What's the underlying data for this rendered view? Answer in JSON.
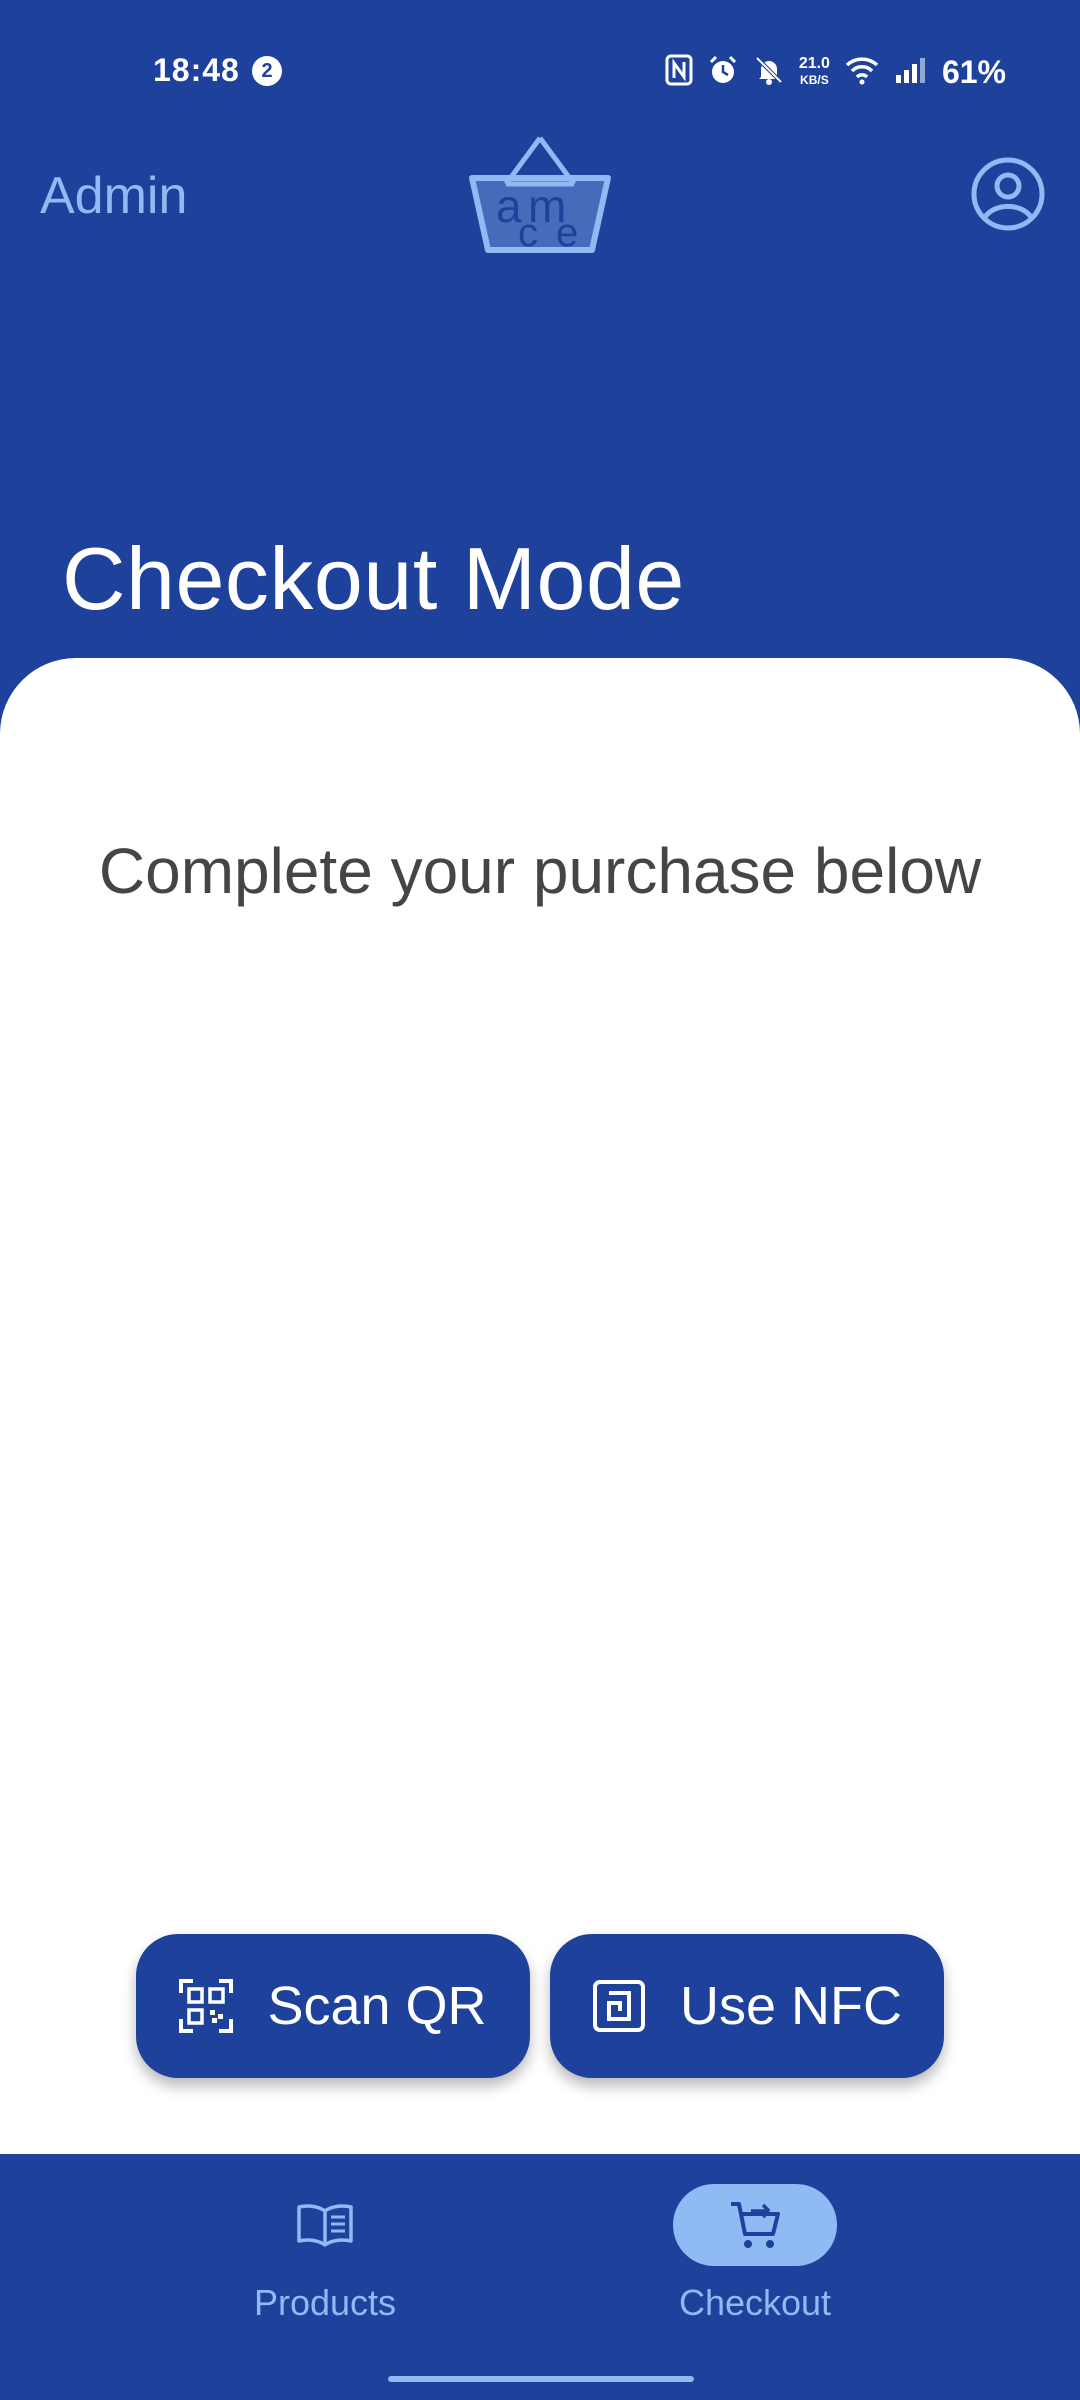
{
  "status_bar": {
    "time": "18:48",
    "notification_count": "2",
    "net_speed_value": "21.0",
    "net_speed_unit": "KB/S",
    "battery": "61%",
    "icons": [
      "nfc-icon",
      "alarm-icon",
      "bell-off-icon",
      "wifi-icon",
      "signal-icon"
    ]
  },
  "header": {
    "admin_label": "Admin",
    "logo_letters": [
      "a",
      "m",
      "c",
      "e"
    ],
    "account_icon": "account-circle-icon"
  },
  "page": {
    "title": "Checkout Mode",
    "subtitle": "Complete your purchase below"
  },
  "actions": {
    "scan_qr": {
      "label": "Scan QR",
      "icon": "qr-scan-icon"
    },
    "use_nfc": {
      "label": "Use NFC",
      "icon": "nfc-icon"
    }
  },
  "bottom_nav": {
    "items": [
      {
        "label": "Products",
        "icon": "book-open-icon",
        "active": false
      },
      {
        "label": "Checkout",
        "icon": "cart-icon",
        "active": true
      }
    ]
  },
  "colors": {
    "primary": "#1e419c",
    "accent": "#8fbaf3",
    "surface": "#ffffff",
    "text_dark": "#444548"
  }
}
